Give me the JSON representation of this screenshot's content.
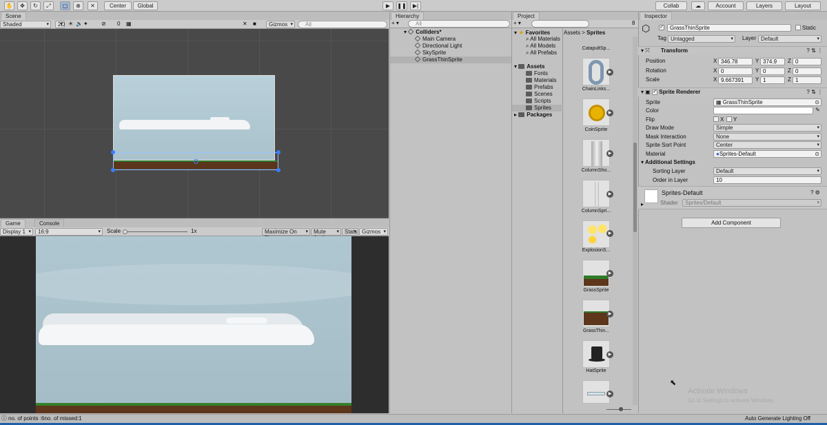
{
  "toolbar": {
    "center": "Center",
    "global": "Global",
    "collab": "Collab",
    "account": "Account",
    "layers": "Layers",
    "layout": "Layout"
  },
  "scene": {
    "tab": "Scene",
    "shading": "Shaded",
    "mode_2d": "2D",
    "hidden_count": "0",
    "gizmos": "Gizmos",
    "search_placeholder": "All"
  },
  "game": {
    "tab": "Game",
    "console_tab": "Console",
    "display": "Display 1",
    "aspect": "16:9",
    "scale_label": "Scale",
    "scale_value": "1x",
    "maximize": "Maximize On Play",
    "mute": "Mute Audio",
    "stats": "Stats",
    "gizmos": "Gizmos"
  },
  "hierarchy": {
    "tab": "Hierarchy",
    "search_placeholder": "All",
    "root": "Colliders*",
    "items": [
      "Main Camera",
      "Directional Light",
      "SkySprite",
      "GrassThinSprite"
    ]
  },
  "project": {
    "tab": "Project",
    "search_placeholder": "",
    "badge": "8",
    "favorites": "Favorites",
    "fav_items": [
      "All Materials",
      "All Models",
      "All Prefabs"
    ],
    "assets": "Assets",
    "folders": [
      "Fonts",
      "Materials",
      "Prefabs",
      "Scenes",
      "Scripts",
      "Sprites"
    ],
    "packages": "Packages",
    "breadcrumb_root": "Assets",
    "breadcrumb_leaf": "Sprites",
    "grid": [
      "CatapultSp...",
      "ChainLinks...",
      "CoinSprite",
      "ColumnSho...",
      "ColumnSpri...",
      "ExplosionS...",
      "GrassSprite",
      "GrassThin...",
      "HatSprite"
    ]
  },
  "inspector": {
    "tab": "Inspector",
    "object_name": "GrassThinSprite",
    "static_label": "Static",
    "tag_label": "Tag",
    "tag_value": "Untagged",
    "layer_label": "Layer",
    "layer_value": "Default",
    "transform": {
      "title": "Transform",
      "position_label": "Position",
      "rotation_label": "Rotation",
      "scale_label": "Scale",
      "axis_x": "X",
      "axis_y": "Y",
      "axis_z": "Z",
      "position": [
        "346.78",
        "374.9",
        "0"
      ],
      "rotation": [
        "0",
        "0",
        "0"
      ],
      "scale": [
        "9.667391",
        "1",
        "1"
      ]
    },
    "sprite_renderer": {
      "title": "Sprite Renderer",
      "sprite_label": "Sprite",
      "sprite_value": "GrassThinSprite",
      "color_label": "Color",
      "flip_label": "Flip",
      "flip_x": "X",
      "flip_y": "Y",
      "draw_mode_label": "Draw Mode",
      "draw_mode_value": "Simple",
      "mask_label": "Mask Interaction",
      "mask_value": "None",
      "sort_point_label": "Sprite Sort Point",
      "sort_point_value": "Center",
      "material_label": "Material",
      "material_value": "Sprites-Default",
      "additional": "Additional Settings",
      "sorting_layer_label": "Sorting Layer",
      "sorting_layer_value": "Default",
      "order_label": "Order in Layer",
      "order_value": "10"
    },
    "material": {
      "name": "Sprites-Default",
      "shader_label": "Shader",
      "shader_value": "Sprites/Default"
    },
    "add_component": "Add Component"
  },
  "watermark": {
    "line1": "Activate Windows",
    "line2": "Go to Settings to activate Windows."
  },
  "status": {
    "message": "no. of points :6no. of missed:1",
    "right": "Auto Generate Lighting Off"
  }
}
